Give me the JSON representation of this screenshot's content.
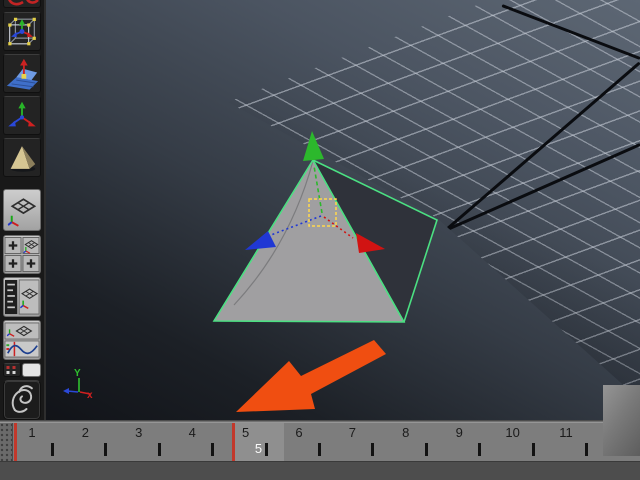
{
  "toolbar": {
    "buttons": [
      {
        "icon": "select-tool-partial-icon"
      },
      {
        "icon": "universal-manipulator-icon"
      },
      {
        "icon": "soft-modification-icon"
      },
      {
        "icon": "move-tool-icon"
      },
      {
        "icon": "polygon-pyramid-icon"
      },
      {
        "icon": "single-pane-layout-icon"
      },
      {
        "icon": "four-pane-layout-icon"
      },
      {
        "icon": "outliner-persp-layout-icon"
      },
      {
        "icon": "persp-graph-layout-icon"
      },
      {
        "icon": "hypergraph-layout-icon"
      },
      {
        "icon": "blank-layout-icon"
      },
      {
        "icon": "paint-effects-dragon-icon"
      }
    ]
  },
  "viewport": {
    "axis_indicator": {
      "y_label": "Y",
      "x_label": "x"
    },
    "selection_color": "#4be082",
    "manipulator": {
      "x_color": "#d11312",
      "y_color": "#2cb82c",
      "z_color": "#2038d4",
      "center_color": "#ffd84d"
    }
  },
  "annotation": {
    "arrow_color": "#f04e11"
  },
  "timeline": {
    "frames": [
      "1",
      "2",
      "3",
      "4",
      "5",
      "6",
      "7",
      "8",
      "9",
      "10",
      "11"
    ],
    "current_frame": "5",
    "start_marker_frame": "1",
    "playhead_frame": "5"
  }
}
